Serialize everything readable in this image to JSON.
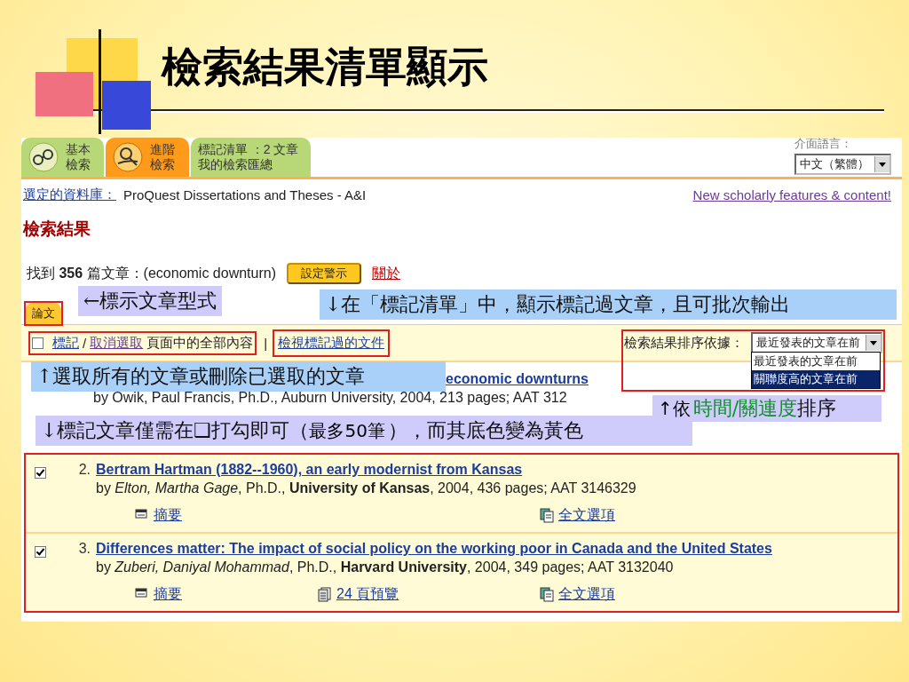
{
  "slide": {
    "title": "檢索結果清單顯示"
  },
  "tabs": [
    {
      "label": "基本檢索",
      "kind": "glasses",
      "selected": false
    },
    {
      "label": "進階檢索",
      "kind": "magnifier",
      "selected": true
    },
    {
      "label": "標記清單 ：2 文章",
      "sublabel": "我的檢索匯總",
      "kind": "plain",
      "selected": false
    }
  ],
  "language": {
    "label": "介面語言：",
    "value": "中文（繁體）"
  },
  "database": {
    "label": "選定的資料庫：",
    "value": "ProQuest Dissertations and Theses - A&I"
  },
  "news_link": "New scholarly features & content!",
  "heading": "檢索結果",
  "found": {
    "text": "找到 **356** 篇文章：(economic downturn)",
    "alert_button": "設定警示",
    "about_link": "關於"
  },
  "doc_type_tag": {
    "label": "論文",
    "highlighted": true
  },
  "toolbar": {
    "checked": false,
    "mark_link": "標記",
    "separator": "/",
    "unselect_link": "取消選取",
    "scope_text": "頁面中的全部內容",
    "bar": "|",
    "mark_highlighted": true,
    "view_link": "檢視標記過的文件",
    "view_highlighted": true,
    "sort_label": "檢索結果排序依據：",
    "sort_value": "最近發表的文章在前",
    "sort_highlighted": true,
    "sort_options": [
      {
        "label": "最近發表的文章在前",
        "selected": false
      },
      {
        "label": "關聯度高的文章在前",
        "selected": true
      }
    ]
  },
  "results": [
    {
      "kind": "partial",
      "title": "economic downturns",
      "byline": "by Owik, Paul Francis, Ph.D., Auburn University, 2004, 213 pages; AAT 312"
    },
    {
      "kind": "full",
      "checked": true,
      "number": "2.",
      "title": "Bertram Hartman (1882--1960), an early modernist from Kansas",
      "byline": "by *Elton, Martha Gage*, Ph.D., **University of Kansas**, 2004, 436 pages; AAT 3146329",
      "links": [
        {
          "kind": "abstract",
          "label": "摘要"
        },
        {
          "kind": "fulltext",
          "label": "全文選項"
        }
      ]
    },
    {
      "kind": "full",
      "checked": true,
      "number": "3.",
      "title": "Differences matter: The impact of social policy on the working poor in Canada and the United States",
      "byline": "by *Zuberi, Daniyal Mohammad*, Ph.D., **Harvard University**, 2004, 349 pages; AAT 3132040",
      "links": [
        {
          "kind": "abstract",
          "label": "摘要"
        },
        {
          "kind": "preview",
          "label": "24 頁預覽"
        },
        {
          "kind": "fulltext",
          "label": "全文選項"
        }
      ]
    }
  ],
  "results_highlighted": true,
  "callouts": [
    {
      "kind": "lavender",
      "parts": [
        {
          "text": "←標示文章型式",
          "kind": "plain"
        }
      ]
    },
    {
      "kind": "blue",
      "parts": [
        {
          "text": "↓在「標記清單」中，顯示標記過文章，且可批次輸出",
          "kind": "plain"
        }
      ]
    },
    {
      "kind": "blue",
      "parts": [
        {
          "text": "↑選取所有的文章或刪除已選取的文章",
          "kind": "plain"
        }
      ]
    },
    {
      "kind": "lavender",
      "parts": [
        {
          "text": "↑依",
          "kind": "small"
        },
        {
          "text": "時間/關連度",
          "kind": "accent"
        },
        {
          "text": "排序",
          "kind": "plain"
        }
      ]
    },
    {
      "kind": "lavender",
      "parts": [
        {
          "text": "↓標記文章僅需在",
          "kind": "plain"
        },
        {
          "text": "❑",
          "kind": "plain"
        },
        {
          "text": "打勾即可（",
          "kind": "plain"
        },
        {
          "text": "最多50筆",
          "kind": "small"
        },
        {
          "text": "），而其底色變為黃色",
          "kind": "plain"
        }
      ]
    }
  ]
}
